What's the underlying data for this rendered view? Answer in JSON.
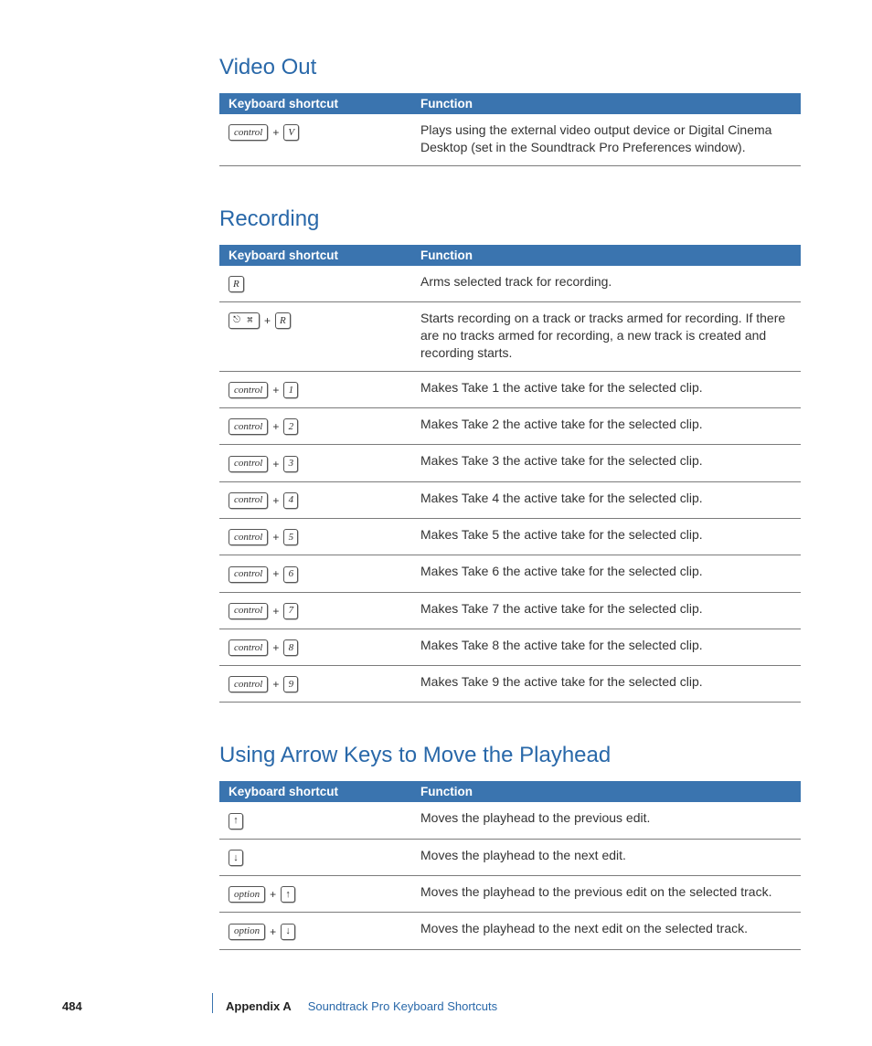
{
  "columns": {
    "shortcut": "Keyboard shortcut",
    "function": "Function"
  },
  "sections": [
    {
      "title": "Video Out",
      "rows": [
        {
          "keys": [
            [
              "control",
              "wide"
            ],
            "+",
            [
              "V",
              "k"
            ]
          ],
          "func": "Plays using the external video output device or Digital Cinema Desktop (set in the Soundtrack Pro Preferences window)."
        }
      ]
    },
    {
      "title": "Recording",
      "rows": [
        {
          "keys": [
            [
              "R",
              "k"
            ]
          ],
          "func": "Arms selected track for recording."
        },
        {
          "keys": [
            [
              "cmd",
              "cmd"
            ],
            "+",
            [
              "R",
              "k"
            ]
          ],
          "func": "Starts recording on a track or tracks armed for recording. If there are no tracks armed for recording, a new track is created and recording starts."
        },
        {
          "keys": [
            [
              "control",
              "wide"
            ],
            "+",
            [
              "1",
              "k"
            ]
          ],
          "func": "Makes Take 1 the active take for the selected clip."
        },
        {
          "keys": [
            [
              "control",
              "wide"
            ],
            "+",
            [
              "2",
              "k"
            ]
          ],
          "func": "Makes Take 2 the active take for the selected clip."
        },
        {
          "keys": [
            [
              "control",
              "wide"
            ],
            "+",
            [
              "3",
              "k"
            ]
          ],
          "func": "Makes Take 3 the active take for the selected clip."
        },
        {
          "keys": [
            [
              "control",
              "wide"
            ],
            "+",
            [
              "4",
              "k"
            ]
          ],
          "func": "Makes Take 4 the active take for the selected clip."
        },
        {
          "keys": [
            [
              "control",
              "wide"
            ],
            "+",
            [
              "5",
              "k"
            ]
          ],
          "func": "Makes Take 5 the active take for the selected clip."
        },
        {
          "keys": [
            [
              "control",
              "wide"
            ],
            "+",
            [
              "6",
              "k"
            ]
          ],
          "func": "Makes Take 6 the active take for the selected clip."
        },
        {
          "keys": [
            [
              "control",
              "wide"
            ],
            "+",
            [
              "7",
              "k"
            ]
          ],
          "func": "Makes Take 7 the active take for the selected clip."
        },
        {
          "keys": [
            [
              "control",
              "wide"
            ],
            "+",
            [
              "8",
              "k"
            ]
          ],
          "func": "Makes Take 8 the active take for the selected clip."
        },
        {
          "keys": [
            [
              "control",
              "wide"
            ],
            "+",
            [
              "9",
              "k"
            ]
          ],
          "func": "Makes Take 9 the active take for the selected clip."
        }
      ]
    },
    {
      "title": "Using Arrow Keys to Move the Playhead",
      "rows": [
        {
          "keys": [
            [
              "↑",
              "arrow"
            ]
          ],
          "func": "Moves the playhead to the previous edit."
        },
        {
          "keys": [
            [
              "↓",
              "arrow"
            ]
          ],
          "func": "Moves the playhead to the next edit."
        },
        {
          "keys": [
            [
              "option",
              "wide"
            ],
            "+",
            [
              "↑",
              "arrow"
            ]
          ],
          "func": "Moves the playhead to the previous edit on the selected track."
        },
        {
          "keys": [
            [
              "option",
              "wide"
            ],
            "+",
            [
              "↓",
              "arrow"
            ]
          ],
          "func": "Moves the playhead to the next edit on the selected track."
        }
      ]
    }
  ],
  "footer": {
    "page": "484",
    "appendix": "Appendix A",
    "title": "Soundtrack Pro Keyboard Shortcuts"
  },
  "glyphs": {
    "cmd": "⎋ ⌘"
  }
}
